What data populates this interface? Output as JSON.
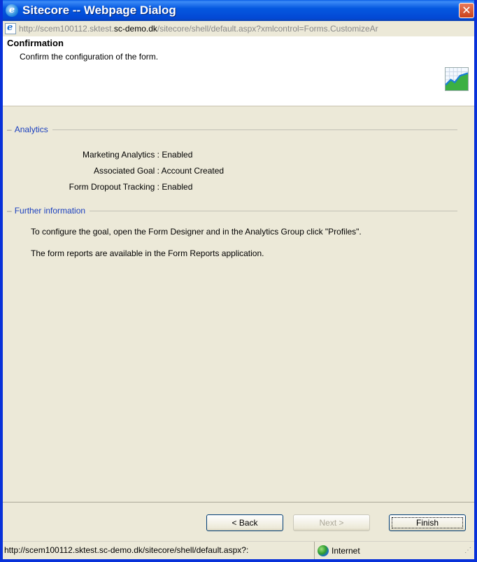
{
  "window": {
    "title": "Sitecore -- Webpage Dialog",
    "close_glyph": "✕"
  },
  "address": {
    "url_prefix": "http://scem100112.sktest.",
    "url_host": "sc-demo.dk",
    "url_suffix": "/sitecore/shell/default.aspx?xmlcontrol=Forms.CustomizeAr"
  },
  "header": {
    "title": "Confirmation",
    "subtitle": "Confirm the configuration of the form.",
    "icon": "chart-icon"
  },
  "analytics": {
    "section_title": "Analytics",
    "rows": [
      {
        "key": "Marketing Analytics :",
        "value": "Enabled"
      },
      {
        "key": "Associated Goal :",
        "value": "Account Created"
      },
      {
        "key": "Form Dropout Tracking :",
        "value": "Enabled"
      }
    ]
  },
  "further": {
    "section_title": "Further information",
    "lines": [
      "To configure the goal, open the Form Designer and in the Analytics Group click \"Profiles\".",
      "The form reports are available in the Form Reports application."
    ]
  },
  "buttons": {
    "back": "< Back",
    "next": "Next >",
    "finish": "Finish"
  },
  "status": {
    "url": "http://scem100112.sktest.sc-demo.dk/sitecore/shell/default.aspx?:",
    "zone": "Internet"
  }
}
